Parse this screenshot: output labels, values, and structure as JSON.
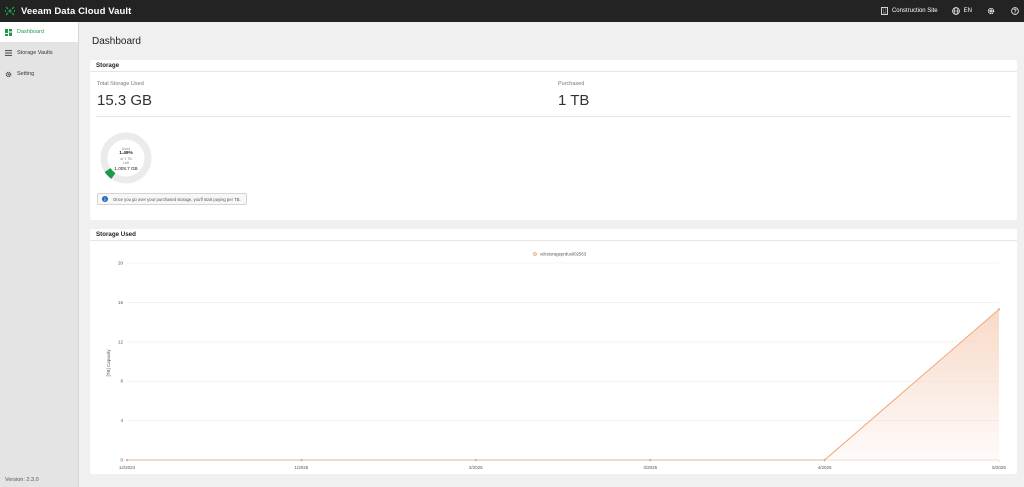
{
  "app": {
    "title": "Veeam Data Cloud Vault"
  },
  "topbar": {
    "org_label": "Construction Site",
    "language": "EN"
  },
  "sidebar": {
    "items": [
      {
        "label": "Dashboard",
        "icon": "dashboard-icon",
        "active": true
      },
      {
        "label": "Storage Vaults",
        "icon": "list-icon",
        "active": false
      },
      {
        "label": "Setting",
        "icon": "gear-icon",
        "active": false
      }
    ],
    "version": "Version: 2.3.0"
  },
  "page": {
    "title": "Dashboard"
  },
  "storage": {
    "header": "Storage",
    "total_label": "Total Storage Used",
    "total_value": "15.3 GB",
    "purchased_label": "Purchased",
    "purchased_value": "1 TB",
    "donut": {
      "used_label": "Used",
      "used_percent": "1.49%",
      "of_label": "of 1 TB",
      "left_label": "Left",
      "left_value": "1,008.7 GB",
      "used_fraction": 0.0149
    },
    "note": "Once you go over your purchased storage, you'll start paying per TB."
  },
  "colors": {
    "accent_green": "#1c9a4a",
    "series_line": "#f0a070",
    "series_fill": "#f7d6c2",
    "info_blue": "#1f66c7",
    "topbar_bg": "#232323"
  },
  "storage_used": {
    "header": "Storage Used"
  },
  "chart_data": {
    "type": "area",
    "title": "",
    "xlabel": "",
    "ylabel": "[TB] Capacity",
    "x": [
      "12/2024",
      "1/2025",
      "2/2025",
      "3/2025",
      "4/2025",
      "5/2025"
    ],
    "ylim": [
      0,
      20
    ],
    "yticks": [
      0,
      4,
      8,
      12,
      16,
      20
    ],
    "grid": true,
    "legend_position": "top-center",
    "series": [
      {
        "name": "vdcstorageprdus002563",
        "values": [
          0,
          0,
          0,
          0,
          0,
          15.3
        ]
      }
    ]
  }
}
